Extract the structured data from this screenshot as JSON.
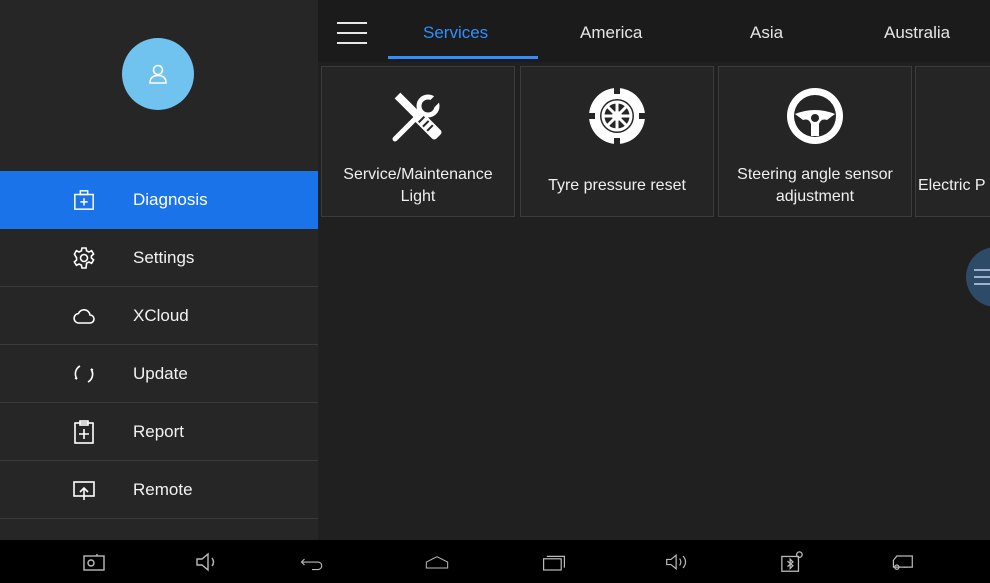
{
  "sidebar": {
    "items": [
      {
        "label": "Diagnosis",
        "icon": "briefcase-plus-icon",
        "active": true
      },
      {
        "label": "Settings",
        "icon": "gear-icon",
        "active": false
      },
      {
        "label": "XCloud",
        "icon": "cloud-icon",
        "active": false
      },
      {
        "label": "Update",
        "icon": "refresh-icon",
        "active": false
      },
      {
        "label": "Report",
        "icon": "clipboard-plus-icon",
        "active": false
      },
      {
        "label": "Remote",
        "icon": "screen-share-icon",
        "active": false
      }
    ]
  },
  "tabs": [
    {
      "label": "Services",
      "active": true
    },
    {
      "label": "America",
      "active": false
    },
    {
      "label": "Asia",
      "active": false
    },
    {
      "label": "Australia",
      "active": false
    }
  ],
  "services": [
    {
      "label": "Service/Maintenance\nLight",
      "icon": "wrench-screwdriver-icon"
    },
    {
      "label": "Tyre pressure reset",
      "icon": "tyre-icon"
    },
    {
      "label": "Steering angle sensor\nadjustment",
      "icon": "steering-wheel-icon"
    },
    {
      "label": "Electric P",
      "icon": "partial-service-icon"
    }
  ],
  "navbar": {
    "icons": [
      "screenshot-icon",
      "volume-down-icon",
      "back-icon",
      "home-icon",
      "recent-apps-icon",
      "volume-up-icon",
      "bluetooth-device-icon",
      "vehicle-connector-icon"
    ]
  },
  "colors": {
    "accent": "#1a73e8",
    "tab_active": "#2f8fff",
    "avatar": "#6fc3ee"
  }
}
